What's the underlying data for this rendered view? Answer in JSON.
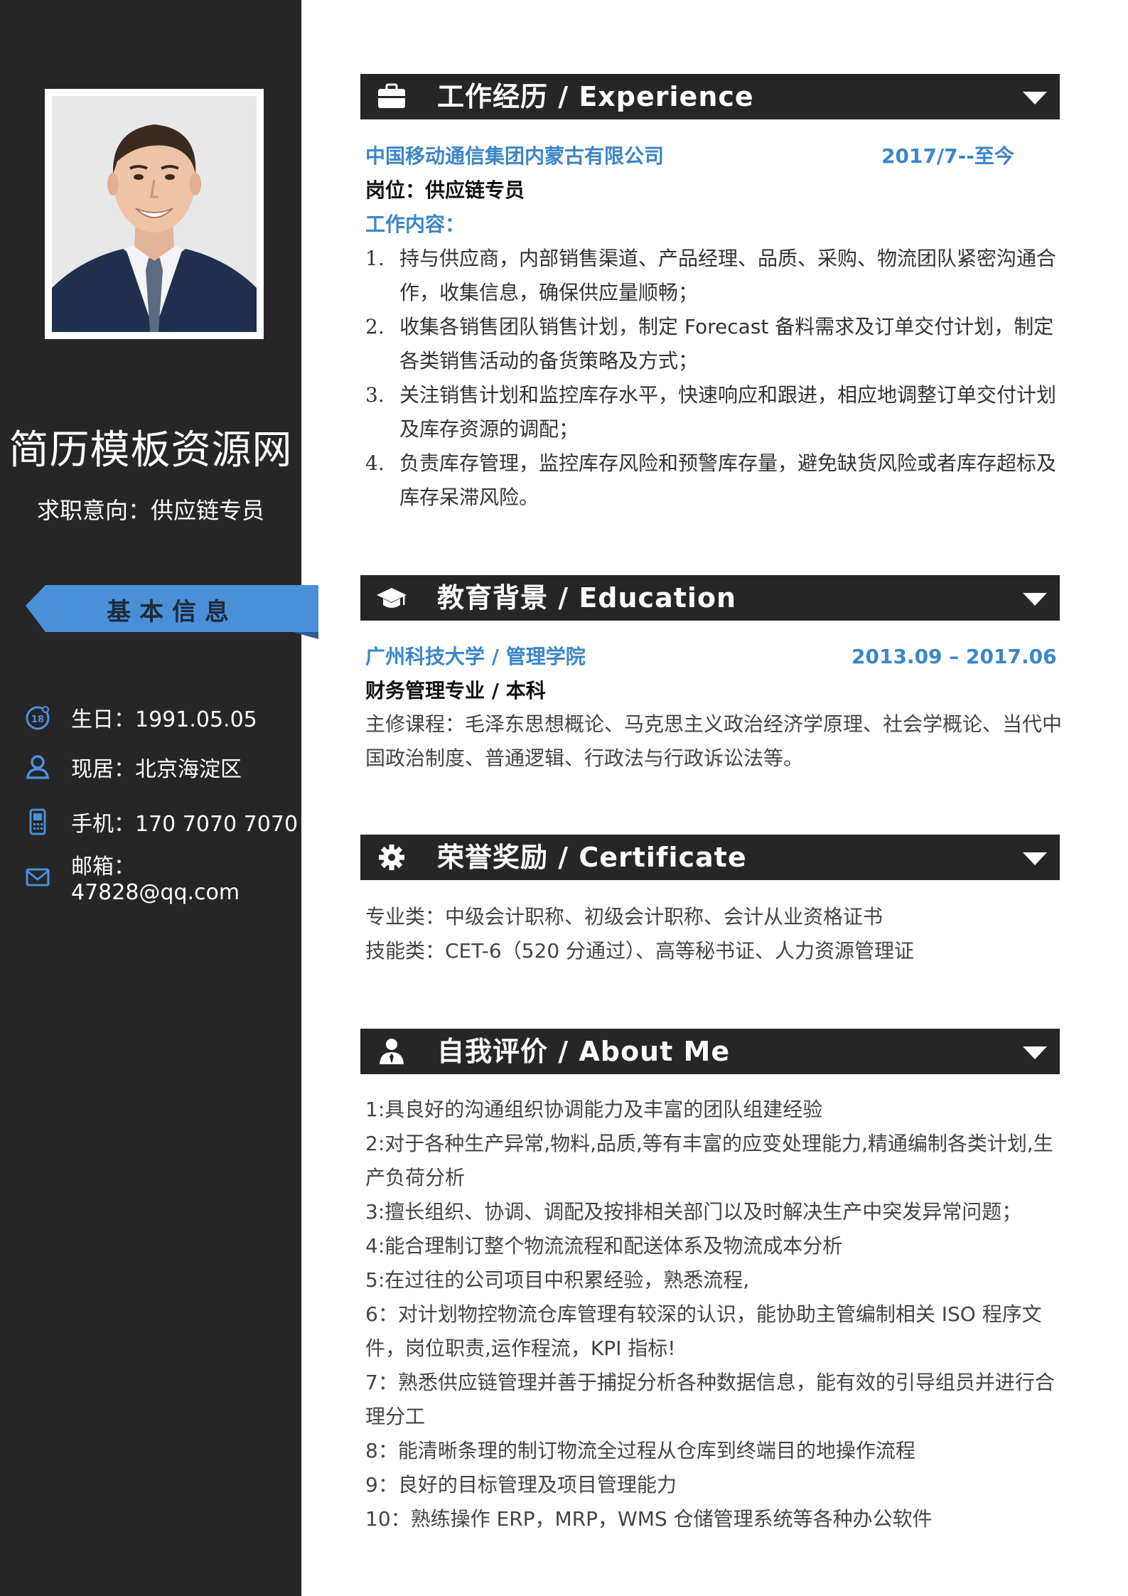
{
  "profile": {
    "name": "简历模板资源网",
    "objective": "求职意向：供应链专员"
  },
  "basic_info": {
    "title": "基本信息",
    "items": [
      {
        "icon": "birthday-icon",
        "text": "生日：1991.05.05"
      },
      {
        "icon": "location-person-icon",
        "text": "现居：北京海淀区"
      },
      {
        "icon": "phone-icon",
        "text": "手机：170 7070 7070"
      },
      {
        "icon": "mail-icon",
        "text": "邮箱：47828@qq.com"
      }
    ]
  },
  "experience": {
    "title": "工作经历 / Experience",
    "company": "中国移动通信集团内蒙古有限公司",
    "period": "2017/7--至今",
    "position": "岗位：供应链专员",
    "content_label": "工作内容：",
    "items": [
      {
        "num": "1.",
        "text": "持与供应商，内部销售渠道、产品经理、品质、采购、物流团队紧密沟通合作，收集信息，确保供应量顺畅；"
      },
      {
        "num": "2.",
        "text": "收集各销售团队销售计划，制定 Forecast 备料需求及订单交付计划，制定各类销售活动的备货策略及方式；"
      },
      {
        "num": "3.",
        "text": "关注销售计划和监控库存水平，快速响应和跟进，相应地调整订单交付计划及库存资源的调配；"
      },
      {
        "num": "4.",
        "text": "负责库存管理，监控库存风险和预警库存量，避免缺货风险或者库存超标及库存呆滞风险。"
      }
    ]
  },
  "education": {
    "title": "教育背景 / Education",
    "school": "广州科技大学 / 管理学院",
    "period": "2013.09 – 2017.06",
    "major": "财务管理专业 / 本科",
    "courses": "主修课程：毛泽东思想概论、马克思主义政治经济学原理、社会学概论、当代中国政治制度、普通逻辑、行政法与行政诉讼法等。"
  },
  "certificate": {
    "title": "荣誉奖励 / Certificate",
    "lines": [
      "专业类：中级会计职称、初级会计职称、会计从业资格证书",
      "技能类：CET-6（520 分通过）、高等秘书证、人力资源管理证"
    ]
  },
  "about": {
    "title": "自我评价 / About Me",
    "lines": [
      "1:具良好的沟通组织协调能力及丰富的团队组建经验",
      "2:对于各种生产异常,物料,品质,等有丰富的应变处理能力,精通编制各类计划,生产负荷分析",
      "3:擅长组织、协调、调配及按排相关部门以及时解决生产中突发异常问题；",
      "4:能合理制订整个物流流程和配送体系及物流成本分析",
      "5:在过往的公司项目中积累经验，熟悉流程,",
      "6：对计划物控物流仓库管理有较深的认识，能协助主管编制相关 ISO 程序文件，岗位职责,运作程流，KPI 指标!",
      "7：熟悉供应链管理并善于捕捉分析各种数据信息，能有效的引导组员并进行合理分工",
      "8：能清晰条理的制订物流全过程从仓库到终端目的地操作流程",
      "9：良好的目标管理及项目管理能力",
      "10：熟练操作 ERP，MRP，WMS 仓储管理系统等各种办公软件"
    ]
  },
  "colors": {
    "sidebar": "#262626",
    "accent_blue": "#3b86c8",
    "ribbon_blue": "#4a90d9",
    "header_bg": "#262626"
  }
}
